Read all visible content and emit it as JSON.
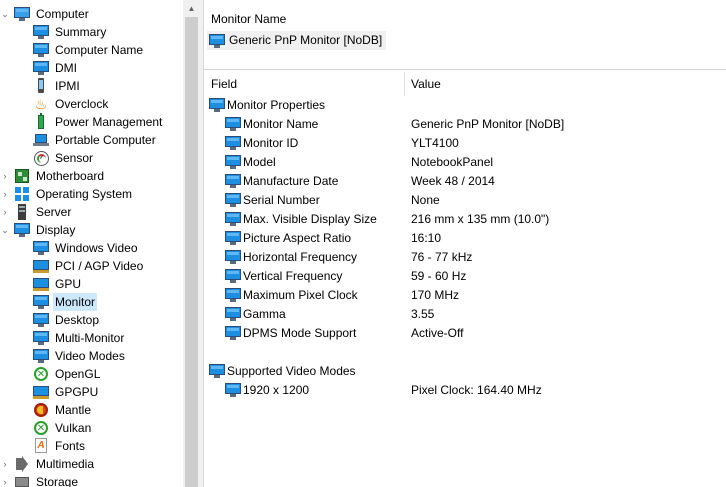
{
  "tree": {
    "items": [
      {
        "label": "Computer",
        "icon": "computer-icon",
        "chevron": "⌄"
      },
      {
        "label": "Summary",
        "icon": "monitor-icon"
      },
      {
        "label": "Computer Name",
        "icon": "monitor-icon"
      },
      {
        "label": "DMI",
        "icon": "monitor-icon"
      },
      {
        "label": "IPMI",
        "icon": "phone-icon"
      },
      {
        "label": "Overclock",
        "icon": "flame-icon"
      },
      {
        "label": "Power Management",
        "icon": "battery-icon"
      },
      {
        "label": "Portable Computer",
        "icon": "laptop-icon"
      },
      {
        "label": "Sensor",
        "icon": "gauge-icon"
      },
      {
        "label": "Motherboard",
        "icon": "motherboard-icon",
        "chevron": "›"
      },
      {
        "label": "Operating System",
        "icon": "windows-icon",
        "chevron": "›"
      },
      {
        "label": "Server",
        "icon": "server-icon",
        "chevron": "›"
      },
      {
        "label": "Display",
        "icon": "monitor-icon",
        "chevron": "⌄"
      },
      {
        "label": "Windows Video",
        "icon": "monitor-icon"
      },
      {
        "label": "PCI / AGP Video",
        "icon": "video-card-icon"
      },
      {
        "label": "GPU",
        "icon": "video-card-icon"
      },
      {
        "label": "Monitor",
        "icon": "monitor-icon"
      },
      {
        "label": "Desktop",
        "icon": "monitor-icon"
      },
      {
        "label": "Multi-Monitor",
        "icon": "monitor-icon"
      },
      {
        "label": "Video Modes",
        "icon": "monitor-icon"
      },
      {
        "label": "OpenGL",
        "icon": "opengl-icon"
      },
      {
        "label": "GPGPU",
        "icon": "gpgpu-icon"
      },
      {
        "label": "Mantle",
        "icon": "mantle-icon"
      },
      {
        "label": "Vulkan",
        "icon": "vulkan-icon"
      },
      {
        "label": "Fonts",
        "icon": "font-icon"
      },
      {
        "label": "Multimedia",
        "icon": "speaker-icon",
        "chevron": "›"
      },
      {
        "label": "Storage",
        "icon": "storage-icon",
        "chevron": "›"
      }
    ]
  },
  "header": {
    "title": "Monitor Name",
    "value": "Generic PnP Monitor [NoDB]"
  },
  "list": {
    "columns": {
      "field": "Field",
      "value": "Value"
    },
    "groups": [
      {
        "title": "Monitor Properties",
        "rows": [
          {
            "field": "Monitor Name",
            "value": "Generic PnP Monitor [NoDB]"
          },
          {
            "field": "Monitor ID",
            "value": "YLT4100"
          },
          {
            "field": "Model",
            "value": "NotebookPanel"
          },
          {
            "field": "Manufacture Date",
            "value": "Week 48 / 2014"
          },
          {
            "field": "Serial Number",
            "value": "None"
          },
          {
            "field": "Max. Visible Display Size",
            "value": "216 mm x 135 mm (10.0\")"
          },
          {
            "field": "Picture Aspect Ratio",
            "value": "16:10"
          },
          {
            "field": "Horizontal Frequency",
            "value": "76 - 77 kHz"
          },
          {
            "field": "Vertical Frequency",
            "value": "59 - 60 Hz"
          },
          {
            "field": "Maximum Pixel Clock",
            "value": "170 MHz"
          },
          {
            "field": "Gamma",
            "value": "3.55"
          },
          {
            "field": "DPMS Mode Support",
            "value": "Active-Off"
          }
        ]
      },
      {
        "title": "Supported Video Modes",
        "rows": [
          {
            "field": "1920 x 1200",
            "value": "Pixel Clock: 164.40 MHz"
          }
        ]
      }
    ]
  },
  "colors": {
    "selection": "#cce8ff",
    "monitor_blue": "#1c8fe0"
  }
}
